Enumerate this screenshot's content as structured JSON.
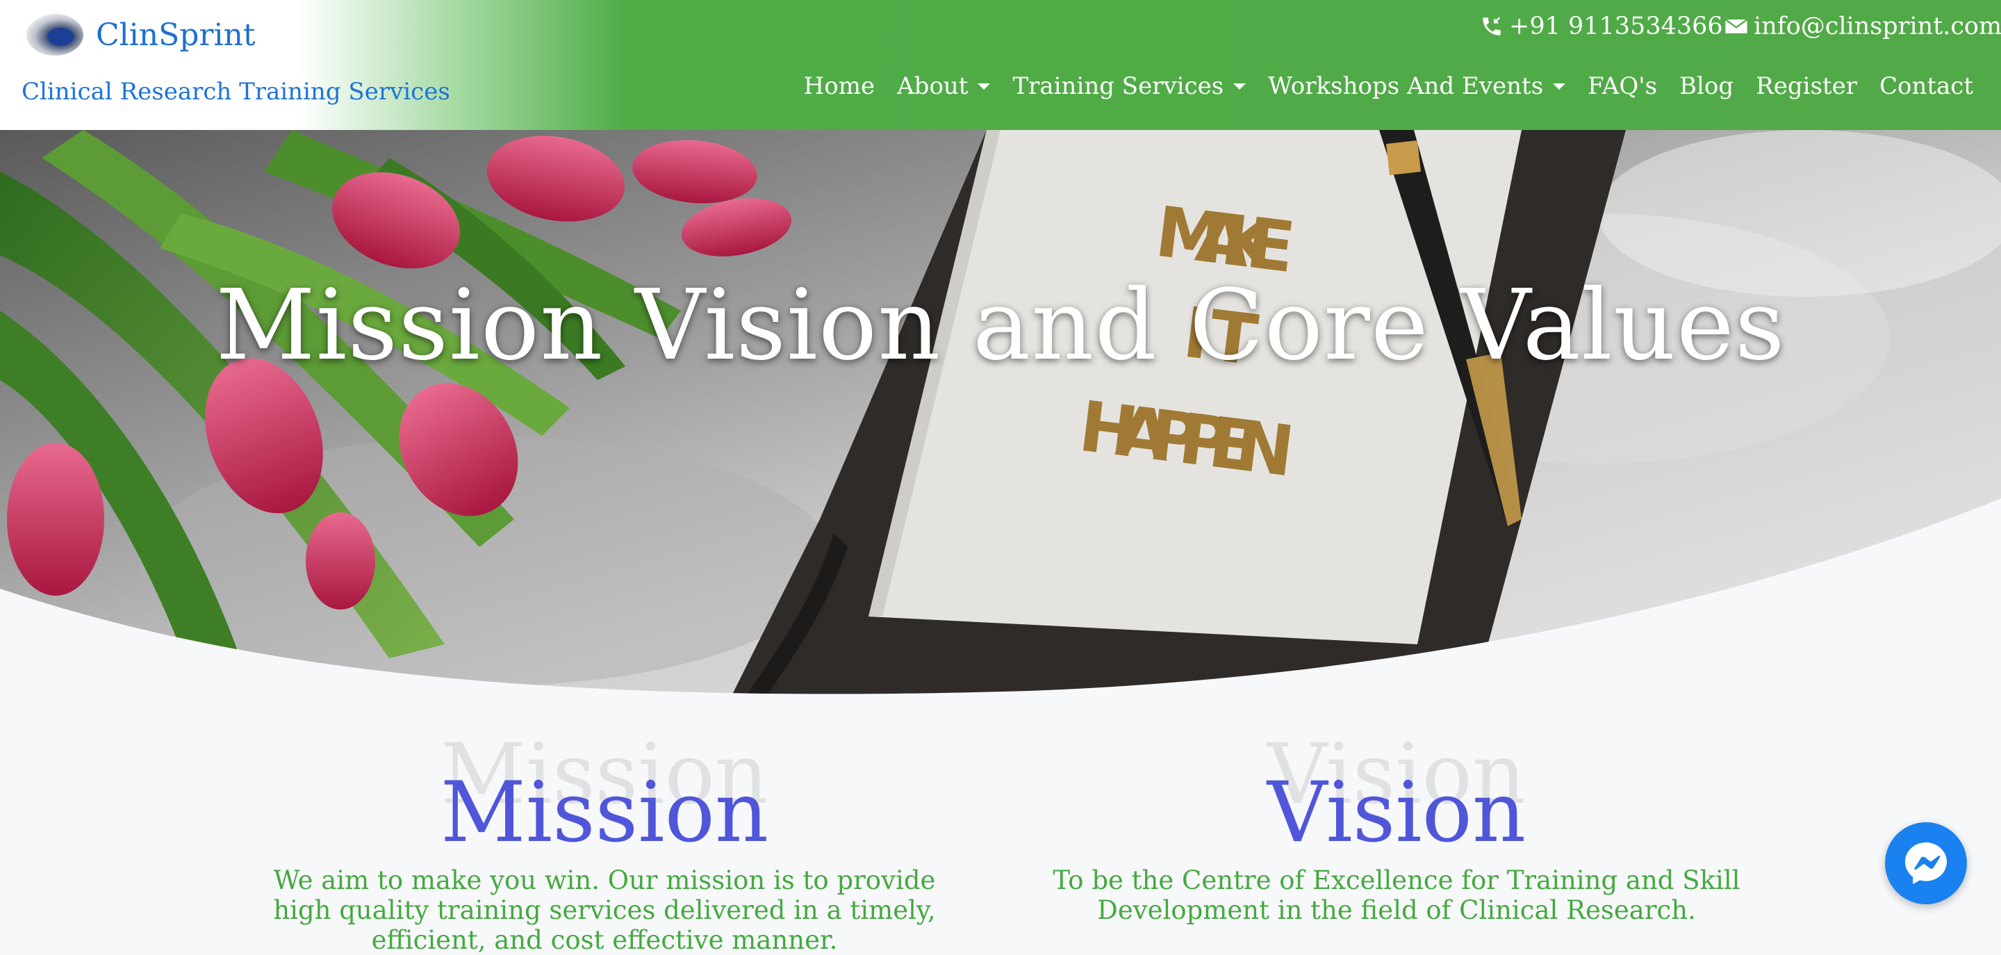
{
  "brand": {
    "name": "ClinSprint",
    "tagline": "Clinical Research Training Services",
    "logo_icon": "clinsprint-logo-icon"
  },
  "contact": {
    "phone": "+91 9113534366",
    "email": "info@clinsprint.com",
    "phone_icon": "phone-icon",
    "email_icon": "envelope-icon"
  },
  "nav": {
    "items": [
      {
        "label": "Home",
        "dropdown": false
      },
      {
        "label": "About",
        "dropdown": true
      },
      {
        "label": "Training Services",
        "dropdown": true
      },
      {
        "label": "Workshops And Events",
        "dropdown": true
      },
      {
        "label": "FAQ's",
        "dropdown": false
      },
      {
        "label": "Blog",
        "dropdown": false
      },
      {
        "label": "Register",
        "dropdown": false
      },
      {
        "label": "Contact",
        "dropdown": false
      }
    ]
  },
  "hero": {
    "title": "Mission Vision and Core Values"
  },
  "mission": {
    "ghost": "Mission",
    "heading": "Mission",
    "line1": "We aim to make you win. Our mission is to provide",
    "line2": "high quality training services delivered in a timely,",
    "line3": "efficient, and cost effective manner."
  },
  "vision": {
    "ghost": "Vision",
    "heading": "Vision",
    "line1": "To be the Centre of Excellence for Training and Skill",
    "line2": "Development in the field of Clinical Research."
  },
  "messenger": {
    "icon": "messenger-icon"
  },
  "colors": {
    "header_green": "#51a947",
    "brand_blue": "#1f6fd0",
    "heading_purple": "#5056d9",
    "text_green": "#44a93f",
    "messenger_blue": "#1a82f0"
  }
}
